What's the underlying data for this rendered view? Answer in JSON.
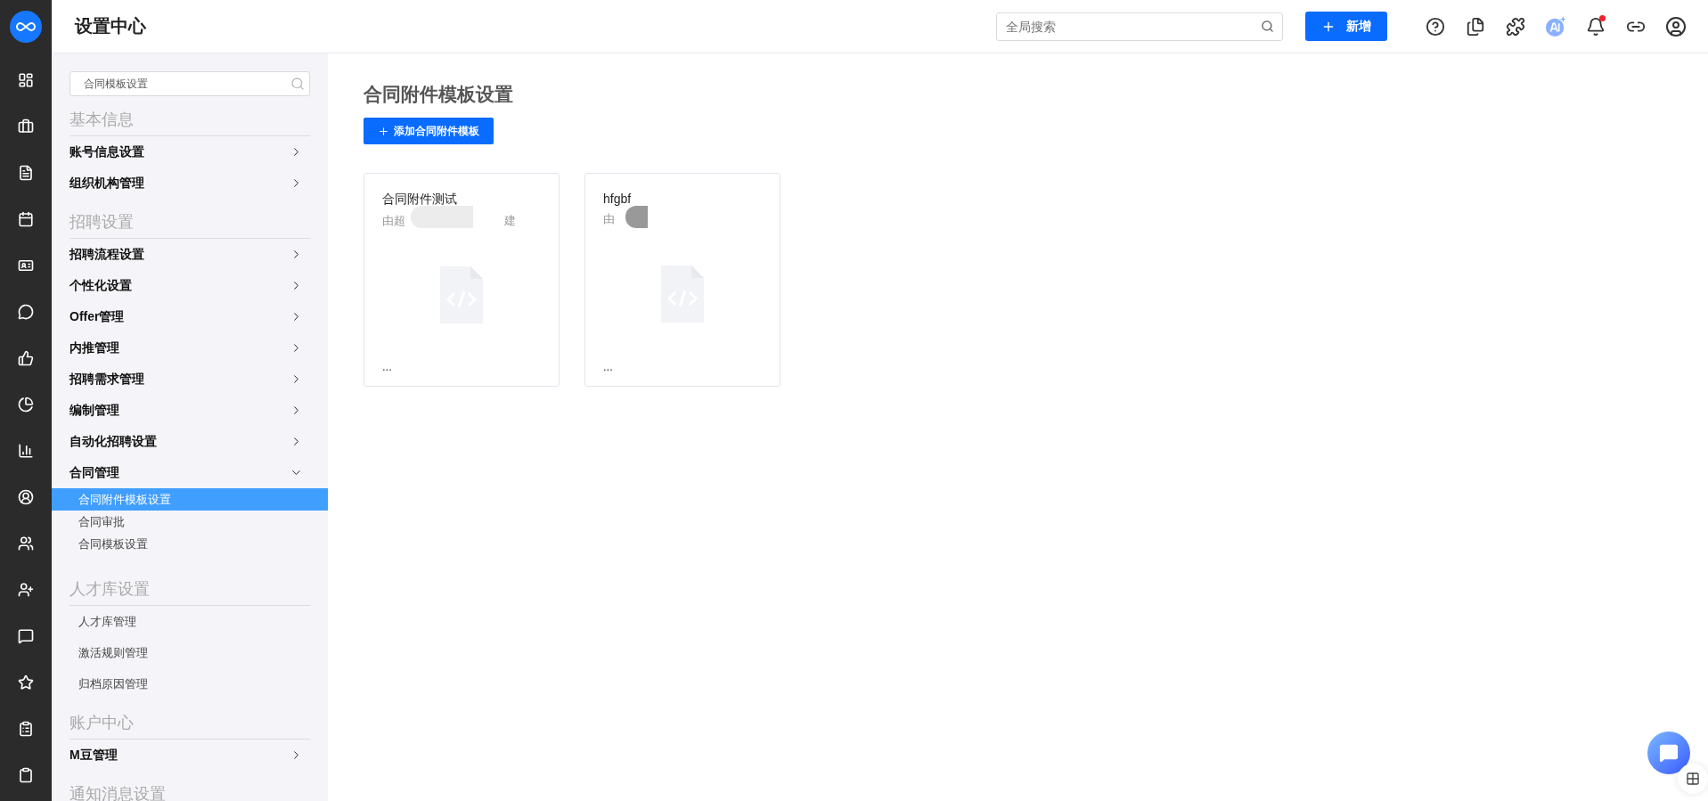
{
  "header": {
    "title": "设置中心",
    "search": {
      "placeholder": "全局搜索"
    },
    "new_button": "新增",
    "notification_badge": true
  },
  "sidebar": {
    "search": {
      "value": "合同模板设置"
    },
    "sections": [
      {
        "title": "基本信息",
        "items": [
          {
            "label": "账号信息设置",
            "kind": "link"
          },
          {
            "label": "组织机构管理",
            "kind": "link"
          }
        ]
      },
      {
        "title": "招聘设置",
        "items": [
          {
            "label": "招聘流程设置",
            "kind": "link"
          },
          {
            "label": "个性化设置",
            "kind": "link"
          },
          {
            "label": "Offer管理",
            "kind": "link"
          },
          {
            "label": "内推管理",
            "kind": "link"
          },
          {
            "label": "招聘需求管理",
            "kind": "link"
          },
          {
            "label": "编制管理",
            "kind": "link"
          },
          {
            "label": "自动化招聘设置",
            "kind": "link"
          },
          {
            "label": "合同管理",
            "kind": "group",
            "expanded": true,
            "children": [
              {
                "label": "合同附件模板设置",
                "selected": true
              },
              {
                "label": "合同审批",
                "selected": false
              },
              {
                "label": "合同模板设置",
                "selected": false
              }
            ]
          }
        ]
      },
      {
        "title": "人才库设置",
        "items": [
          {
            "label": "人才库管理",
            "kind": "plain"
          },
          {
            "label": "激活规则管理",
            "kind": "plain"
          },
          {
            "label": "归档原因管理",
            "kind": "plain"
          }
        ]
      },
      {
        "title": "账户中心",
        "items": [
          {
            "label": "M豆管理",
            "kind": "link"
          }
        ]
      },
      {
        "title": "通知消息设置"
      }
    ]
  },
  "main": {
    "title": "合同附件模板设置",
    "add_button": "添加合同附件模板",
    "cards": [
      {
        "title": "合同附件测试",
        "subtitle_start": "由超",
        "subtitle_end": "建",
        "more": "..."
      },
      {
        "title": "hfgbf",
        "subtitle_start": "由",
        "more": "..."
      }
    ]
  }
}
